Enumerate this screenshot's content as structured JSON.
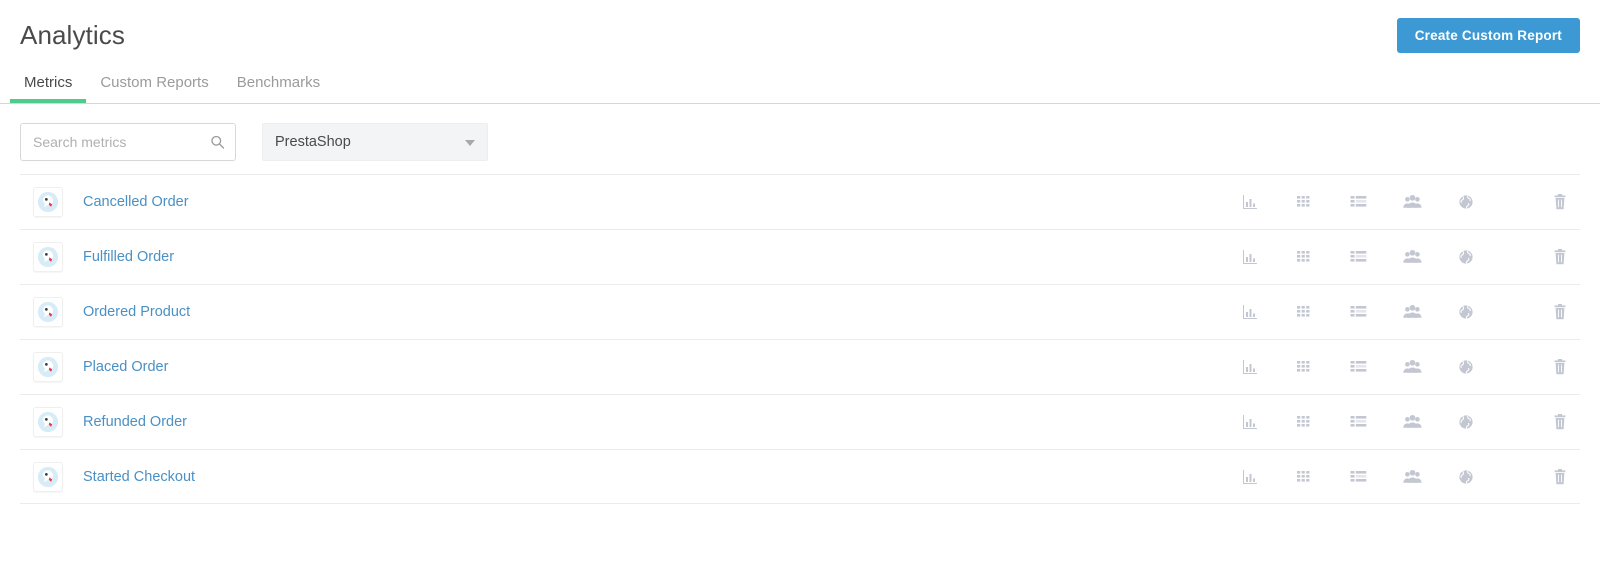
{
  "header": {
    "title": "Analytics",
    "create_report_label": "Create Custom Report",
    "tabs": [
      {
        "label": "Metrics",
        "active": true
      },
      {
        "label": "Custom Reports",
        "active": false
      },
      {
        "label": "Benchmarks",
        "active": false
      }
    ]
  },
  "filters": {
    "search": {
      "placeholder": "Search metrics",
      "value": "",
      "icon": "search-icon"
    },
    "source_select": {
      "value": "PrestaShop",
      "icon": "chevron-down-icon"
    }
  },
  "metrics": {
    "rows": [
      {
        "name": "Cancelled Order",
        "avatar": "prestashop-logo-icon"
      },
      {
        "name": "Fulfilled Order",
        "avatar": "prestashop-logo-icon"
      },
      {
        "name": "Ordered Product",
        "avatar": "prestashop-logo-icon"
      },
      {
        "name": "Placed Order",
        "avatar": "prestashop-logo-icon"
      },
      {
        "name": "Refunded Order",
        "avatar": "prestashop-logo-icon"
      },
      {
        "name": "Started Checkout",
        "avatar": "prestashop-logo-icon"
      }
    ],
    "actions": [
      {
        "name": "chart-icon"
      },
      {
        "name": "grid-icon"
      },
      {
        "name": "list-detail-icon"
      },
      {
        "name": "people-icon"
      },
      {
        "name": "globe-icon"
      },
      {
        "name": "trash-icon"
      }
    ]
  },
  "colors": {
    "accent_blue": "#3d99d3",
    "tab_active_underline": "#4ecb8d",
    "link_blue": "#4a90c4",
    "icon_gray": "#c3c7d1",
    "title_gray": "#4a4a4a"
  }
}
